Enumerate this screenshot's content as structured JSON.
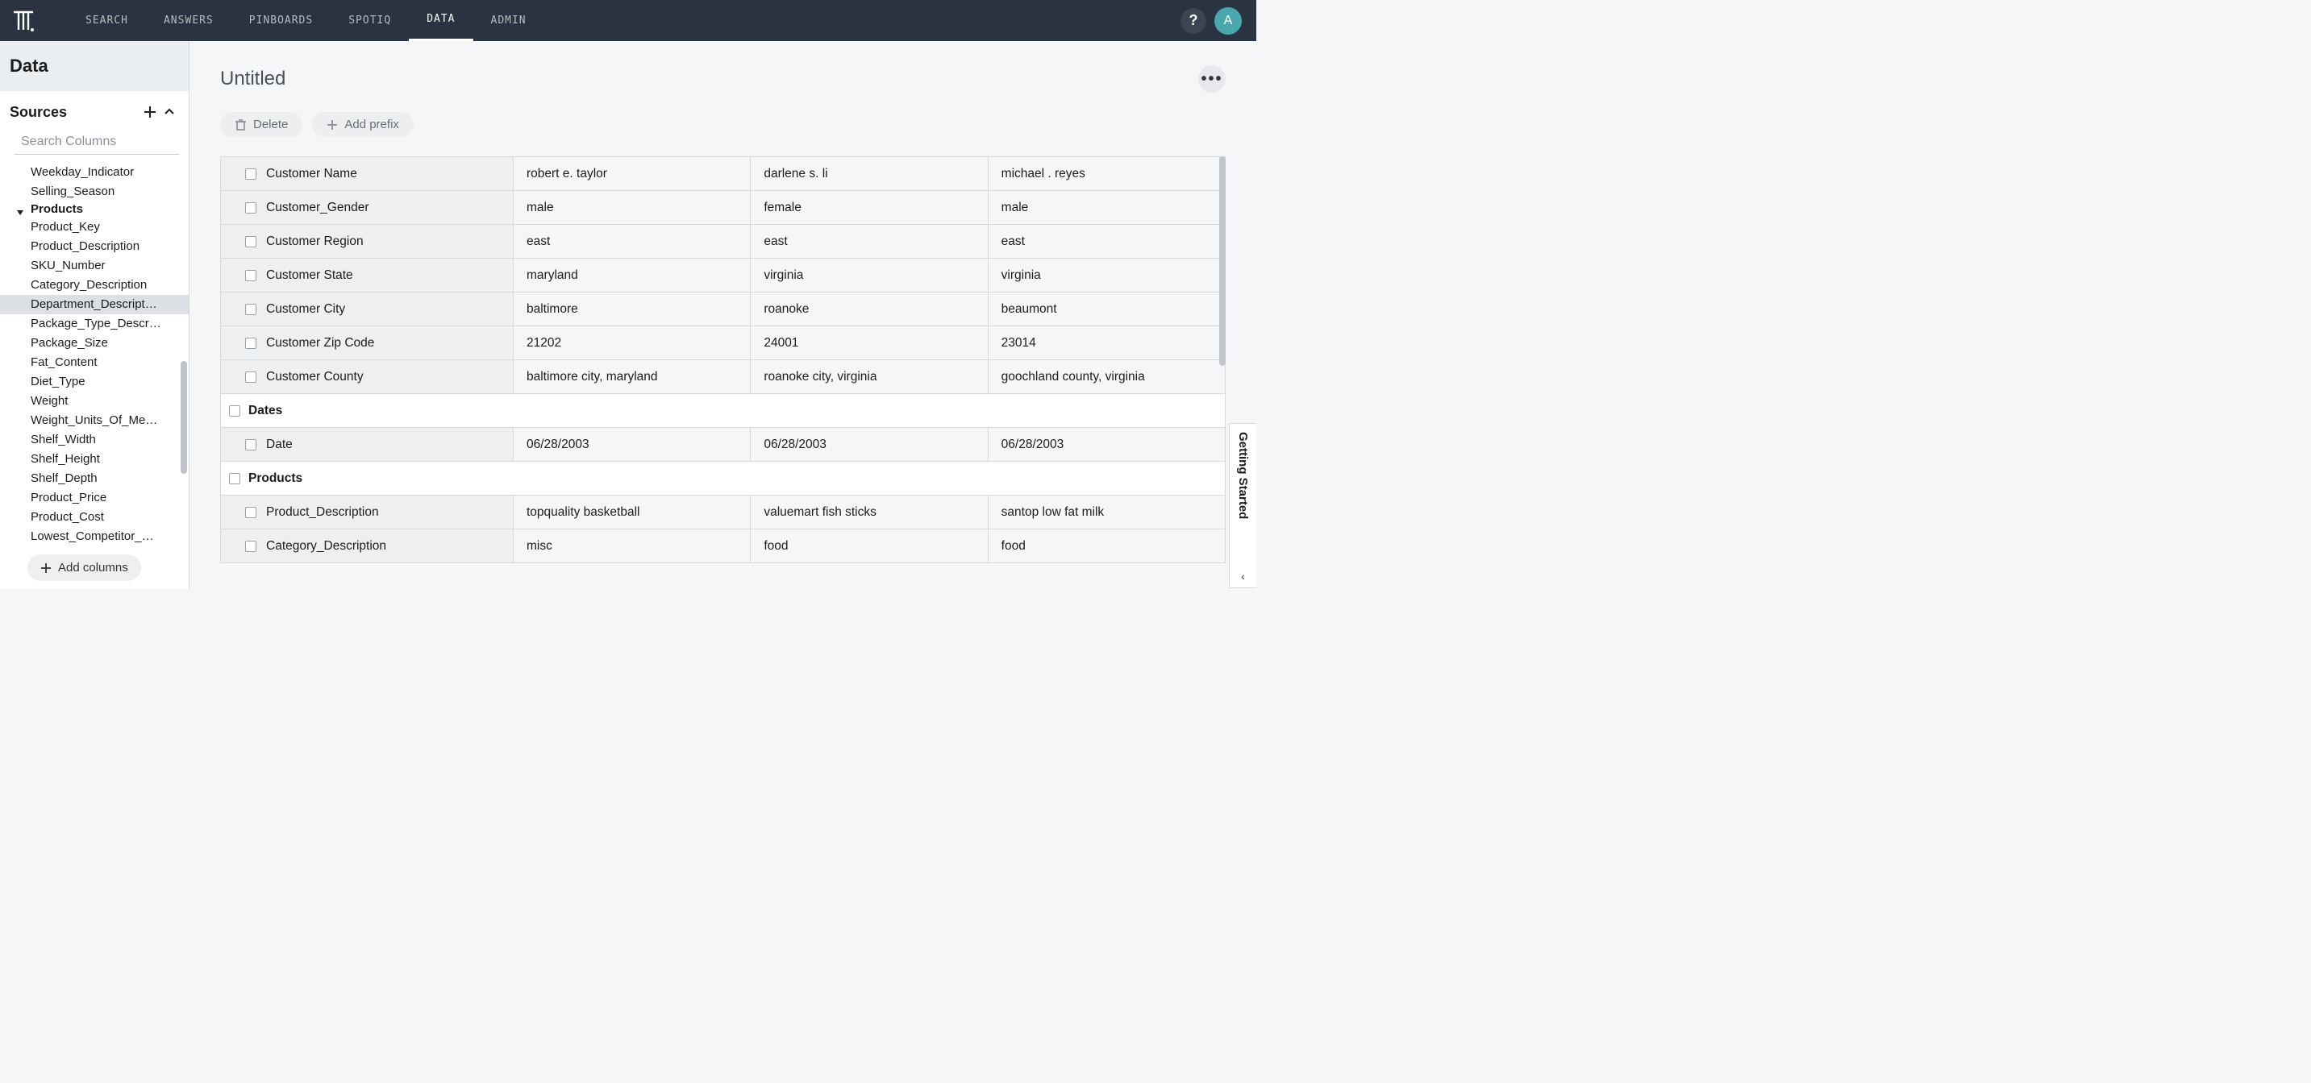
{
  "nav": {
    "items": [
      "SEARCH",
      "ANSWERS",
      "PINBOARDS",
      "SPOTIQ",
      "DATA",
      "ADMIN"
    ],
    "active_index": 4
  },
  "avatar_initial": "A",
  "sidebar": {
    "title": "Data",
    "sources_label": "Sources",
    "search_placeholder": "Search Columns",
    "tree": [
      {
        "type": "item",
        "label": "Weekday_Indicator"
      },
      {
        "type": "item",
        "label": "Selling_Season"
      },
      {
        "type": "group",
        "label": "Products"
      },
      {
        "type": "item",
        "label": "Product_Key"
      },
      {
        "type": "item",
        "label": "Product_Description"
      },
      {
        "type": "item",
        "label": "SKU_Number"
      },
      {
        "type": "item",
        "label": "Category_Description"
      },
      {
        "type": "item",
        "label": "Department_Descript…",
        "selected": true
      },
      {
        "type": "item",
        "label": "Package_Type_Descr…"
      },
      {
        "type": "item",
        "label": "Package_Size"
      },
      {
        "type": "item",
        "label": "Fat_Content"
      },
      {
        "type": "item",
        "label": "Diet_Type"
      },
      {
        "type": "item",
        "label": "Weight"
      },
      {
        "type": "item",
        "label": "Weight_Units_Of_Me…"
      },
      {
        "type": "item",
        "label": "Shelf_Width"
      },
      {
        "type": "item",
        "label": "Shelf_Height"
      },
      {
        "type": "item",
        "label": "Shelf_Depth"
      },
      {
        "type": "item",
        "label": "Product_Price"
      },
      {
        "type": "item",
        "label": "Product_Cost"
      },
      {
        "type": "item",
        "label": "Lowest_Competitor_…"
      }
    ],
    "add_columns_label": "Add columns"
  },
  "main": {
    "title": "Untitled",
    "delete_label": "Delete",
    "add_prefix_label": "Add prefix",
    "rows": [
      {
        "type": "attr",
        "name": "Customer Name",
        "values": [
          "robert e. taylor",
          "darlene s. li",
          "michael . reyes"
        ]
      },
      {
        "type": "attr",
        "name": "Customer_Gender",
        "values": [
          "male",
          "female",
          "male"
        ]
      },
      {
        "type": "attr",
        "name": "Customer Region",
        "values": [
          "east",
          "east",
          "east"
        ]
      },
      {
        "type": "attr",
        "name": "Customer State",
        "values": [
          "maryland",
          "virginia",
          "virginia"
        ]
      },
      {
        "type": "attr",
        "name": "Customer City",
        "values": [
          "baltimore",
          "roanoke",
          "beaumont"
        ]
      },
      {
        "type": "attr",
        "name": "Customer Zip Code",
        "values": [
          "21202",
          "24001",
          "23014"
        ]
      },
      {
        "type": "attr",
        "name": "Customer County",
        "values": [
          "baltimore city, maryland",
          "roanoke city, virginia",
          "goochland county, virginia"
        ]
      },
      {
        "type": "section",
        "name": "Dates"
      },
      {
        "type": "attr",
        "name": "Date",
        "values": [
          "06/28/2003",
          "06/28/2003",
          "06/28/2003"
        ]
      },
      {
        "type": "section",
        "name": "Products"
      },
      {
        "type": "attr",
        "name": "Product_Description",
        "values": [
          "topquality basketball",
          "valuemart fish sticks",
          "santop low fat milk"
        ]
      },
      {
        "type": "attr",
        "name": "Category_Description",
        "values": [
          "misc",
          "food",
          "food"
        ]
      }
    ]
  },
  "getting_started_label": "Getting Started"
}
